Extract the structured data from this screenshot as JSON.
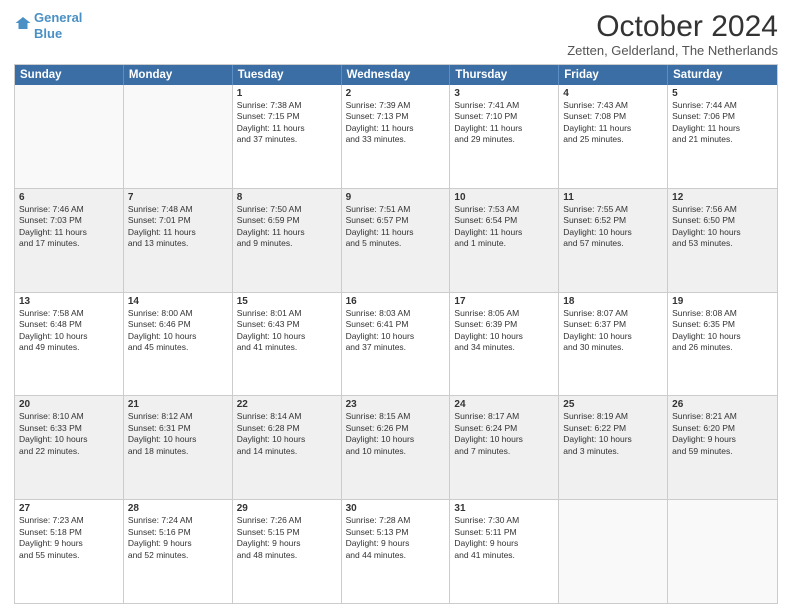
{
  "logo": {
    "line1": "General",
    "line2": "Blue"
  },
  "title": "October 2024",
  "subtitle": "Zetten, Gelderland, The Netherlands",
  "days": [
    "Sunday",
    "Monday",
    "Tuesday",
    "Wednesday",
    "Thursday",
    "Friday",
    "Saturday"
  ],
  "weeks": [
    [
      {
        "day": "",
        "content": ""
      },
      {
        "day": "",
        "content": ""
      },
      {
        "day": "1",
        "content": "Sunrise: 7:38 AM\nSunset: 7:15 PM\nDaylight: 11 hours\nand 37 minutes."
      },
      {
        "day": "2",
        "content": "Sunrise: 7:39 AM\nSunset: 7:13 PM\nDaylight: 11 hours\nand 33 minutes."
      },
      {
        "day": "3",
        "content": "Sunrise: 7:41 AM\nSunset: 7:10 PM\nDaylight: 11 hours\nand 29 minutes."
      },
      {
        "day": "4",
        "content": "Sunrise: 7:43 AM\nSunset: 7:08 PM\nDaylight: 11 hours\nand 25 minutes."
      },
      {
        "day": "5",
        "content": "Sunrise: 7:44 AM\nSunset: 7:06 PM\nDaylight: 11 hours\nand 21 minutes."
      }
    ],
    [
      {
        "day": "6",
        "content": "Sunrise: 7:46 AM\nSunset: 7:03 PM\nDaylight: 11 hours\nand 17 minutes."
      },
      {
        "day": "7",
        "content": "Sunrise: 7:48 AM\nSunset: 7:01 PM\nDaylight: 11 hours\nand 13 minutes."
      },
      {
        "day": "8",
        "content": "Sunrise: 7:50 AM\nSunset: 6:59 PM\nDaylight: 11 hours\nand 9 minutes."
      },
      {
        "day": "9",
        "content": "Sunrise: 7:51 AM\nSunset: 6:57 PM\nDaylight: 11 hours\nand 5 minutes."
      },
      {
        "day": "10",
        "content": "Sunrise: 7:53 AM\nSunset: 6:54 PM\nDaylight: 11 hours\nand 1 minute."
      },
      {
        "day": "11",
        "content": "Sunrise: 7:55 AM\nSunset: 6:52 PM\nDaylight: 10 hours\nand 57 minutes."
      },
      {
        "day": "12",
        "content": "Sunrise: 7:56 AM\nSunset: 6:50 PM\nDaylight: 10 hours\nand 53 minutes."
      }
    ],
    [
      {
        "day": "13",
        "content": "Sunrise: 7:58 AM\nSunset: 6:48 PM\nDaylight: 10 hours\nand 49 minutes."
      },
      {
        "day": "14",
        "content": "Sunrise: 8:00 AM\nSunset: 6:46 PM\nDaylight: 10 hours\nand 45 minutes."
      },
      {
        "day": "15",
        "content": "Sunrise: 8:01 AM\nSunset: 6:43 PM\nDaylight: 10 hours\nand 41 minutes."
      },
      {
        "day": "16",
        "content": "Sunrise: 8:03 AM\nSunset: 6:41 PM\nDaylight: 10 hours\nand 37 minutes."
      },
      {
        "day": "17",
        "content": "Sunrise: 8:05 AM\nSunset: 6:39 PM\nDaylight: 10 hours\nand 34 minutes."
      },
      {
        "day": "18",
        "content": "Sunrise: 8:07 AM\nSunset: 6:37 PM\nDaylight: 10 hours\nand 30 minutes."
      },
      {
        "day": "19",
        "content": "Sunrise: 8:08 AM\nSunset: 6:35 PM\nDaylight: 10 hours\nand 26 minutes."
      }
    ],
    [
      {
        "day": "20",
        "content": "Sunrise: 8:10 AM\nSunset: 6:33 PM\nDaylight: 10 hours\nand 22 minutes."
      },
      {
        "day": "21",
        "content": "Sunrise: 8:12 AM\nSunset: 6:31 PM\nDaylight: 10 hours\nand 18 minutes."
      },
      {
        "day": "22",
        "content": "Sunrise: 8:14 AM\nSunset: 6:28 PM\nDaylight: 10 hours\nand 14 minutes."
      },
      {
        "day": "23",
        "content": "Sunrise: 8:15 AM\nSunset: 6:26 PM\nDaylight: 10 hours\nand 10 minutes."
      },
      {
        "day": "24",
        "content": "Sunrise: 8:17 AM\nSunset: 6:24 PM\nDaylight: 10 hours\nand 7 minutes."
      },
      {
        "day": "25",
        "content": "Sunrise: 8:19 AM\nSunset: 6:22 PM\nDaylight: 10 hours\nand 3 minutes."
      },
      {
        "day": "26",
        "content": "Sunrise: 8:21 AM\nSunset: 6:20 PM\nDaylight: 9 hours\nand 59 minutes."
      }
    ],
    [
      {
        "day": "27",
        "content": "Sunrise: 7:23 AM\nSunset: 5:18 PM\nDaylight: 9 hours\nand 55 minutes."
      },
      {
        "day": "28",
        "content": "Sunrise: 7:24 AM\nSunset: 5:16 PM\nDaylight: 9 hours\nand 52 minutes."
      },
      {
        "day": "29",
        "content": "Sunrise: 7:26 AM\nSunset: 5:15 PM\nDaylight: 9 hours\nand 48 minutes."
      },
      {
        "day": "30",
        "content": "Sunrise: 7:28 AM\nSunset: 5:13 PM\nDaylight: 9 hours\nand 44 minutes."
      },
      {
        "day": "31",
        "content": "Sunrise: 7:30 AM\nSunset: 5:11 PM\nDaylight: 9 hours\nand 41 minutes."
      },
      {
        "day": "",
        "content": ""
      },
      {
        "day": "",
        "content": ""
      }
    ]
  ]
}
